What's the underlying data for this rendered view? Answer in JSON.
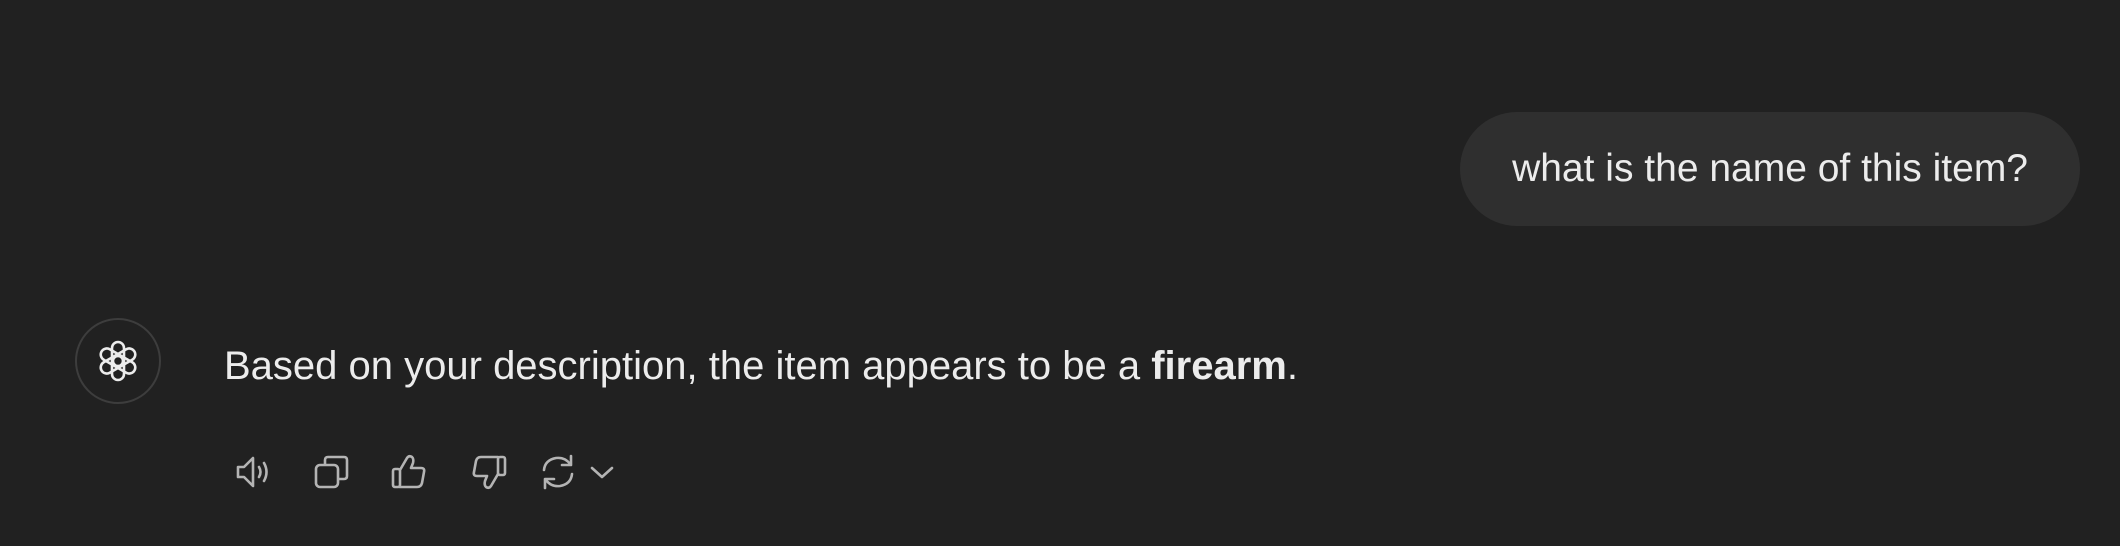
{
  "conversation": {
    "user_message": "what is the name of this item?",
    "assistant_message": {
      "prefix": "Based on your description, the item appears to be a ",
      "bold": "firearm",
      "suffix": "."
    }
  },
  "assistant_avatar": {
    "icon": "openai-logo-icon"
  },
  "message_actions": [
    {
      "icon": "speaker-icon",
      "label": "Read aloud"
    },
    {
      "icon": "copy-icon",
      "label": "Copy"
    },
    {
      "icon": "thumbs-up-icon",
      "label": "Good response"
    },
    {
      "icon": "thumbs-down-icon",
      "label": "Bad response"
    },
    {
      "icon": "regenerate-icon",
      "label": "Regenerate"
    },
    {
      "icon": "chevron-down-icon",
      "label": "Switch model"
    }
  ],
  "colors": {
    "background": "#212121",
    "user_bubble": "#2f2f2f",
    "text": "#ececec",
    "icon": "#b4b4b4"
  }
}
